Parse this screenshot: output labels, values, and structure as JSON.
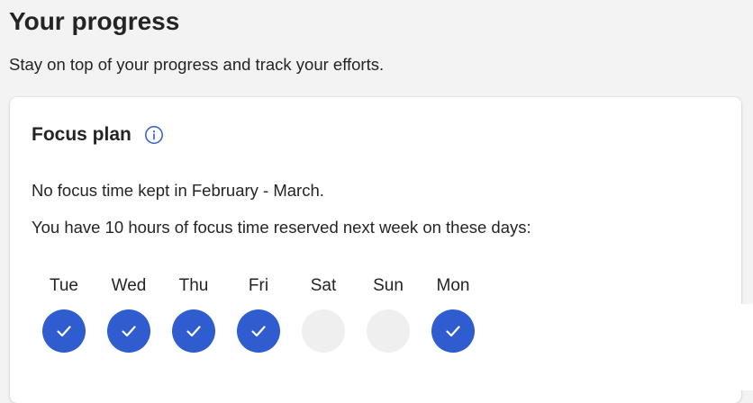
{
  "page": {
    "title": "Your progress",
    "subtitle": "Stay on top of your progress and track your efforts."
  },
  "focus_plan": {
    "title": "Focus plan",
    "info_icon": "info-icon",
    "status_text": "No focus time kept in February - March.",
    "reserved_text": "You have 10 hours of focus time reserved next week on these days:",
    "days": [
      {
        "label": "Tue",
        "selected": true
      },
      {
        "label": "Wed",
        "selected": true
      },
      {
        "label": "Thu",
        "selected": true
      },
      {
        "label": "Fri",
        "selected": true
      },
      {
        "label": "Sat",
        "selected": false
      },
      {
        "label": "Sun",
        "selected": false
      },
      {
        "label": "Mon",
        "selected": true
      }
    ]
  },
  "colors": {
    "accent": "#2f5ccf",
    "empty_day": "#efefef",
    "background": "#f3f3f3",
    "card": "#ffffff",
    "text": "#242424"
  }
}
